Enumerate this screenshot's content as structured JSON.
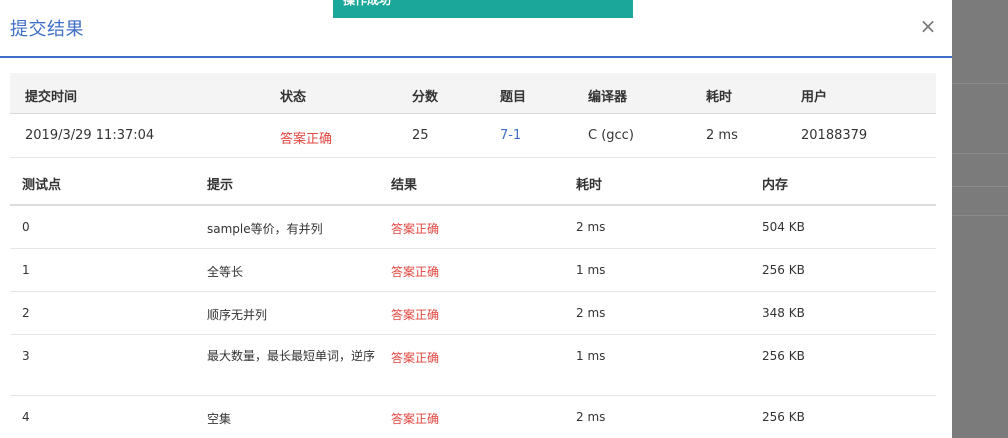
{
  "toast": {
    "text": "操作成功"
  },
  "modal": {
    "title": "提交结果",
    "close_icon": "×"
  },
  "submission": {
    "headers": [
      "提交时间",
      "状态",
      "分数",
      "题目",
      "编译器",
      "耗时",
      "用户"
    ],
    "row": {
      "time": "2019/3/29 11:37:04",
      "status": "答案正确",
      "score": "25",
      "problem": "7-1",
      "compiler": "C (gcc)",
      "elapsed": "2 ms",
      "user": "20188379"
    }
  },
  "testcases": {
    "headers": [
      "测试点",
      "提示",
      "结果",
      "耗时",
      "内存"
    ],
    "rows": [
      {
        "id": "0",
        "hint": "sample等价，有并列",
        "result": "答案正确",
        "time": "2 ms",
        "memory": "504 KB"
      },
      {
        "id": "1",
        "hint": "全等长",
        "result": "答案正确",
        "time": "1 ms",
        "memory": "256 KB"
      },
      {
        "id": "2",
        "hint": "顺序无并列",
        "result": "答案正确",
        "time": "2 ms",
        "memory": "348 KB"
      },
      {
        "id": "3",
        "hint": "最大数量，最长最短单词，逆序",
        "result": "答案正确",
        "time": "1 ms",
        "memory": "256 KB"
      },
      {
        "id": "4",
        "hint": "空集",
        "result": "答案正确",
        "time": "2 ms",
        "memory": "256 KB"
      }
    ]
  },
  "colors": {
    "accent": "#3f6fc6",
    "toast": "#1ba79a",
    "accepted": "#e0463f"
  }
}
